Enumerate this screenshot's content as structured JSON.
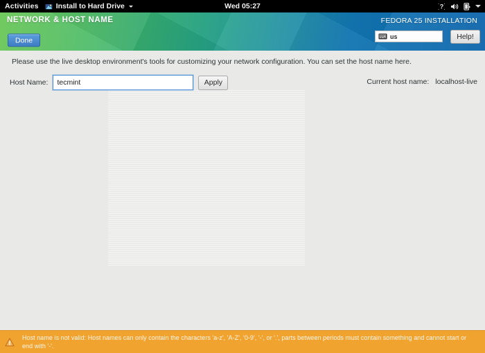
{
  "topbar": {
    "activities": "Activities",
    "app_menu_label": "Install to Hard Drive",
    "app_menu_icon": "installer-icon",
    "clock": "Wed 05:27",
    "tray_icons": [
      "accessibility-question-icon",
      "volume-icon",
      "battery-icon",
      "system-menu-chevron-icon"
    ]
  },
  "header": {
    "title": "NETWORK & HOST NAME",
    "done_label": "Done",
    "installation_label": "FEDORA 25 INSTALLATION",
    "keyboard_layout": "us",
    "keyboard_icon": "keyboard-icon",
    "help_label": "Help!",
    "gradient_start": "#5fc34a",
    "gradient_end": "#0b66b0",
    "done_button_color": "#3f7cc4"
  },
  "main": {
    "intro": "Please use the live desktop environment's tools for customizing your network configuration.  You can set the host name here.",
    "host_name_label": "Host Name:",
    "host_name_value": "tecmint",
    "host_name_placeholder": "",
    "apply_label": "Apply",
    "current_host_name_label": "Current host name:",
    "current_host_name_value": "localhost-live"
  },
  "warning": {
    "icon": "warning-triangle-icon",
    "message": "Host name is not valid: Host names can only contain the characters 'a-z', 'A-Z', '0-9', '-', or '.', parts between periods must contain something and cannot start or end with '-'.",
    "background_color": "#f0a32e"
  }
}
